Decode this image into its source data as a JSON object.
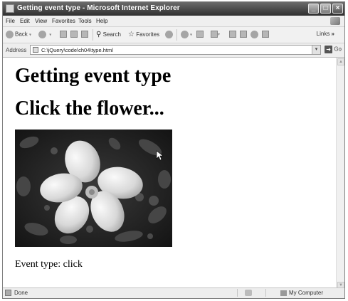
{
  "window": {
    "title": "Getting event type - Microsoft Internet Explorer"
  },
  "menu": [
    "File",
    "Edit",
    "View",
    "Favorites",
    "Tools",
    "Help"
  ],
  "toolbar": {
    "back": "Back",
    "search": "Search",
    "favorites": "Favorites",
    "links": "Links"
  },
  "address": {
    "label": "Address",
    "url": "C:\\jQuery\\code\\ch04\\type.html",
    "go": "Go"
  },
  "page": {
    "heading1": "Getting event type",
    "heading2": "Click the flower...",
    "event_text": "Event type: click"
  },
  "status": {
    "text": "Done",
    "zone": "My Computer"
  }
}
